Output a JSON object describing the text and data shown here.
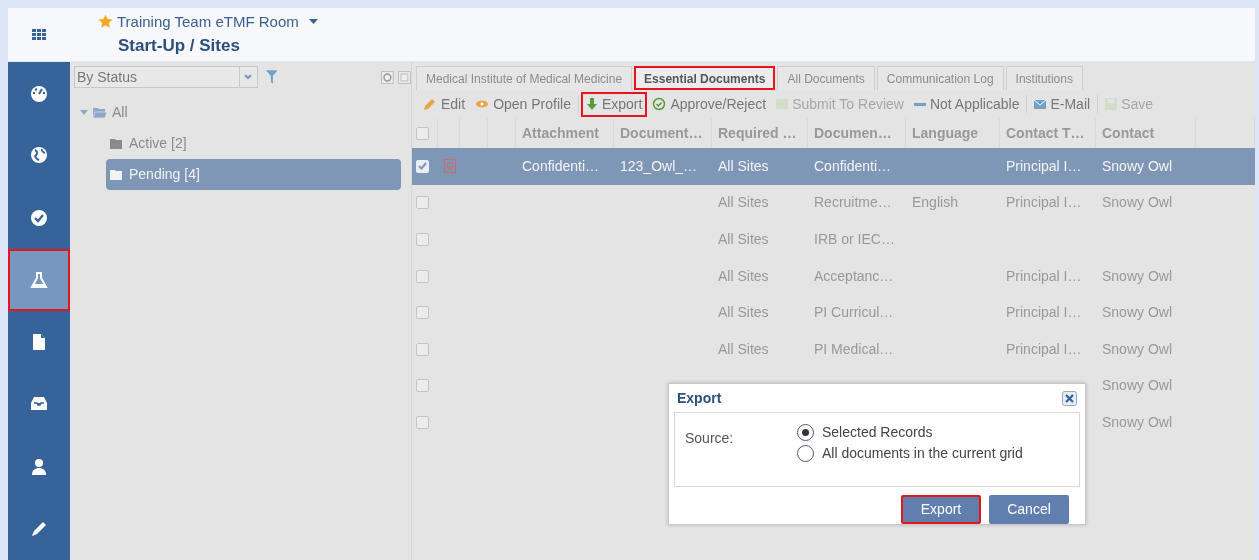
{
  "header": {
    "room": "Training Team eTMF Room",
    "title": "Start-Up / Sites"
  },
  "sidebar": {
    "items": [
      {
        "kind": "dashboard",
        "selected": false,
        "highlighted": false
      },
      {
        "kind": "globe",
        "selected": false,
        "highlighted": false
      },
      {
        "kind": "check",
        "selected": false,
        "highlighted": false
      },
      {
        "kind": "flask",
        "selected": true,
        "highlighted": true
      },
      {
        "kind": "file",
        "selected": false,
        "highlighted": false
      },
      {
        "kind": "inbox",
        "selected": false,
        "highlighted": false
      },
      {
        "kind": "user",
        "selected": false,
        "highlighted": false
      },
      {
        "kind": "pencil",
        "selected": false,
        "highlighted": false
      }
    ]
  },
  "filter": {
    "value": "By Status"
  },
  "tree": [
    {
      "label": "All",
      "expanded": true,
      "selected": false,
      "children": [
        {
          "label": "Active [2]",
          "selected": false
        },
        {
          "label": "Pending [4]",
          "selected": true
        }
      ]
    }
  ],
  "tabs": [
    {
      "label": "Medical Institute of Medical Medicine",
      "selected": false,
      "highlighted": false
    },
    {
      "label": "Essential Documents",
      "selected": true,
      "highlighted": true
    },
    {
      "label": "All Documents",
      "selected": false,
      "highlighted": false
    },
    {
      "label": "Communication Log",
      "selected": false,
      "highlighted": false
    },
    {
      "label": "Institutions",
      "selected": false,
      "highlighted": false
    }
  ],
  "toolbar": [
    {
      "kind": "edit",
      "label": "Edit",
      "disabled": false,
      "highlighted": false
    },
    {
      "kind": "eye",
      "label": "Open Profile",
      "disabled": false,
      "highlighted": false
    },
    {
      "kind": "export",
      "label": "Export",
      "disabled": false,
      "highlighted": true
    },
    {
      "kind": "approve",
      "label": "Approve/Reject",
      "disabled": false,
      "highlighted": false
    },
    {
      "kind": "submit",
      "label": "Submit To Review",
      "disabled": true,
      "highlighted": false
    },
    {
      "kind": "na",
      "label": "Not Applicable",
      "disabled": false,
      "highlighted": false
    },
    {
      "kind": "mail",
      "label": "E-Mail",
      "disabled": false,
      "highlighted": false
    },
    {
      "kind": "save",
      "label": "Save",
      "disabled": true,
      "highlighted": false
    }
  ],
  "table": {
    "select_all": {
      "checked": false
    },
    "columns": [
      "Attachment",
      "Document…",
      "Required …",
      "Documen…",
      "Language",
      "Contact T…",
      "Contact"
    ],
    "rows": [
      {
        "checked": true,
        "selected": true,
        "has_file": true,
        "cells": [
          "Confidenti…",
          "123_Owl_…",
          "All Sites",
          "Confidenti…",
          "",
          "Principal I…",
          "Snowy Owl"
        ]
      },
      {
        "checked": false,
        "selected": false,
        "has_file": false,
        "cells": [
          "",
          "",
          "All Sites",
          "Recruitme…",
          "English",
          "Principal I…",
          "Snowy Owl"
        ]
      },
      {
        "checked": false,
        "selected": false,
        "has_file": false,
        "cells": [
          "",
          "",
          "All Sites",
          "IRB or IEC…",
          "",
          "",
          ""
        ]
      },
      {
        "checked": false,
        "selected": false,
        "has_file": false,
        "cells": [
          "",
          "",
          "All Sites",
          "Acceptanc…",
          "",
          "Principal I…",
          "Snowy Owl"
        ]
      },
      {
        "checked": false,
        "selected": false,
        "has_file": false,
        "cells": [
          "",
          "",
          "All Sites",
          "PI Curricul…",
          "",
          "Principal I…",
          "Snowy Owl"
        ]
      },
      {
        "checked": false,
        "selected": false,
        "has_file": false,
        "cells": [
          "",
          "",
          "All Sites",
          "PI Medical…",
          "",
          "Principal I…",
          "Snowy Owl"
        ]
      },
      {
        "checked": false,
        "selected": false,
        "has_file": false,
        "cells": [
          "",
          "",
          "",
          "",
          "",
          "",
          "Snowy Owl"
        ]
      },
      {
        "checked": false,
        "selected": false,
        "has_file": false,
        "cells": [
          "",
          "",
          "",
          "",
          "",
          "",
          "Snowy Owl"
        ]
      }
    ]
  },
  "dialog": {
    "title": "Export",
    "source_label": "Source:",
    "options": [
      {
        "label": "Selected Records",
        "selected": true
      },
      {
        "label": "All documents in the current grid",
        "selected": false
      }
    ],
    "buttons": [
      {
        "label": "Export",
        "highlighted": true
      },
      {
        "label": "Cancel",
        "highlighted": false
      }
    ]
  }
}
